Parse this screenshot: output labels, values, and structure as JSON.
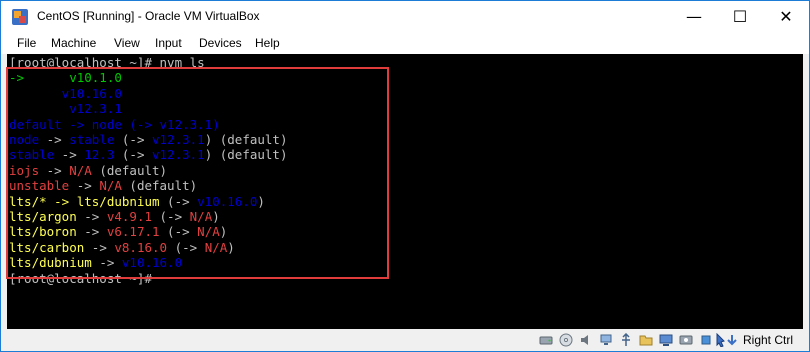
{
  "window": {
    "title": "CentOS [Running] - Oracle VM VirtualBox",
    "controls": {
      "minimize": "—",
      "maximize": "☐",
      "close": "✕"
    }
  },
  "menu": [
    "File",
    "Machine",
    "View",
    "Input",
    "Devices",
    "Help"
  ],
  "terminal": {
    "lines": [
      [
        {
          "t": "[root@localhost ~]# nvm ls",
          "c": "gray"
        }
      ],
      [
        {
          "t": "->      v10.1.0",
          "c": "green"
        }
      ],
      [
        {
          "t": "       v10.16.0",
          "c": "blue"
        }
      ],
      [
        {
          "t": "        v12.3.1",
          "c": "blue"
        }
      ],
      [
        {
          "t": "default -> node (-> v12.3.1)",
          "c": "blue"
        }
      ],
      [
        {
          "t": "node",
          "c": "blue"
        },
        {
          "t": " -> ",
          "c": "gray"
        },
        {
          "t": "stable",
          "c": "blue"
        },
        {
          "t": " (-> ",
          "c": "gray"
        },
        {
          "t": "v12.3.1",
          "c": "blue"
        },
        {
          "t": ") (default)",
          "c": "gray"
        }
      ],
      [
        {
          "t": "stable",
          "c": "blue"
        },
        {
          "t": " -> ",
          "c": "gray"
        },
        {
          "t": "12.3",
          "c": "blue"
        },
        {
          "t": " (-> ",
          "c": "gray"
        },
        {
          "t": "v12.3.1",
          "c": "blue"
        },
        {
          "t": ") (default)",
          "c": "gray"
        }
      ],
      [
        {
          "t": "iojs",
          "c": "red"
        },
        {
          "t": " -> ",
          "c": "gray"
        },
        {
          "t": "N/A",
          "c": "red"
        },
        {
          "t": " (default)",
          "c": "gray"
        }
      ],
      [
        {
          "t": "unstable",
          "c": "red"
        },
        {
          "t": " -> ",
          "c": "gray"
        },
        {
          "t": "N/A",
          "c": "red"
        },
        {
          "t": " (default)",
          "c": "gray"
        }
      ],
      [
        {
          "t": "lts/* -> lts/dubnium",
          "c": "yellow"
        },
        {
          "t": " (-> ",
          "c": "gray"
        },
        {
          "t": "v10.16.0",
          "c": "blue"
        },
        {
          "t": ")",
          "c": "gray"
        }
      ],
      [
        {
          "t": "lts/argon",
          "c": "yellow"
        },
        {
          "t": " -> ",
          "c": "gray"
        },
        {
          "t": "v4.9.1",
          "c": "red"
        },
        {
          "t": " (-> ",
          "c": "gray"
        },
        {
          "t": "N/A",
          "c": "red"
        },
        {
          "t": ")",
          "c": "gray"
        }
      ],
      [
        {
          "t": "lts/boron",
          "c": "yellow"
        },
        {
          "t": " -> ",
          "c": "gray"
        },
        {
          "t": "v6.17.1",
          "c": "red"
        },
        {
          "t": " (-> ",
          "c": "gray"
        },
        {
          "t": "N/A",
          "c": "red"
        },
        {
          "t": ")",
          "c": "gray"
        }
      ],
      [
        {
          "t": "lts/carbon",
          "c": "yellow"
        },
        {
          "t": " -> ",
          "c": "gray"
        },
        {
          "t": "v8.16.0",
          "c": "red"
        },
        {
          "t": " (-> ",
          "c": "gray"
        },
        {
          "t": "N/A",
          "c": "red"
        },
        {
          "t": ")",
          "c": "gray"
        }
      ],
      [
        {
          "t": "lts/dubnium",
          "c": "yellow"
        },
        {
          "t": " -> ",
          "c": "gray"
        },
        {
          "t": "v10.16.0",
          "c": "blue"
        }
      ],
      [
        {
          "t": "[root@localhost ~]# ",
          "c": "gray"
        }
      ]
    ]
  },
  "status": {
    "icons": [
      "hard-disk-icon",
      "optical-drive-icon",
      "audio-icon",
      "network-icon",
      "usb-icon",
      "shared-folders-icon",
      "display-icon",
      "recording-icon",
      "cpu-icon",
      "mouse-integration-icon",
      "keyboard-capture-icon"
    ],
    "host_key": "Right Ctrl"
  },
  "colors": {
    "gray": "#c0c0c0",
    "green": "#00c800",
    "blue": "#0000c8",
    "red": "#e04040",
    "yellow": "#ffff54",
    "highlight": "#e03c3c"
  }
}
